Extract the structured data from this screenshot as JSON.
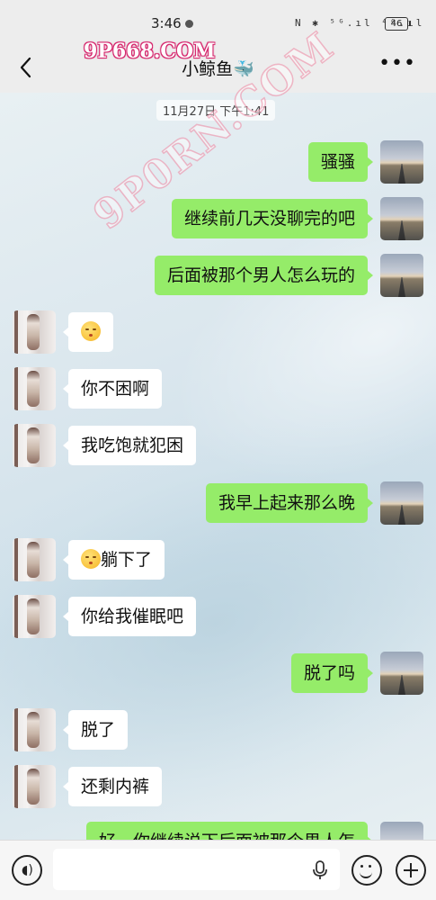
{
  "status_bar": {
    "time": "3:46",
    "signal_text": "N ✱ ⁵ᴳ.ıl ⁴ᴳ.ıl",
    "battery": "46"
  },
  "nav": {
    "title": "小鲸鱼🐳"
  },
  "watermarks": {
    "top": "9P668.COM",
    "diagonal": "9P0RN.COM"
  },
  "chat": {
    "timestamp": "11月27日 下午1:41",
    "messages": [
      {
        "side": "right",
        "text": "骚骚",
        "emoji": false
      },
      {
        "side": "right",
        "text": "继续前几天没聊完的吧",
        "emoji": false
      },
      {
        "side": "right",
        "text": "后面被那个男人怎么玩的",
        "emoji": false
      },
      {
        "side": "left",
        "text": "",
        "emoji": true
      },
      {
        "side": "left",
        "text": "你不困啊",
        "emoji": false
      },
      {
        "side": "left",
        "text": "我吃饱就犯困",
        "emoji": false
      },
      {
        "side": "right",
        "text": "我早上起来那么晚",
        "emoji": false
      },
      {
        "side": "left",
        "text": "躺下了",
        "emoji": true
      },
      {
        "side": "left",
        "text": "你给我催眠吧",
        "emoji": false
      },
      {
        "side": "right",
        "text": "脱了吗",
        "emoji": false
      },
      {
        "side": "left",
        "text": "脱了",
        "emoji": false
      },
      {
        "side": "left",
        "text": "还剩内裤",
        "emoji": false
      },
      {
        "side": "right",
        "text": "好，你继续说下后面被那个男人怎",
        "emoji": false
      }
    ]
  },
  "input_bar": {
    "icons": [
      "voice-icon",
      "microphone-icon",
      "emoji-icon",
      "plus-icon"
    ]
  },
  "colors": {
    "my_bubble": "#95ec69",
    "their_bubble": "#ffffff",
    "bar_background": "#ededed"
  }
}
